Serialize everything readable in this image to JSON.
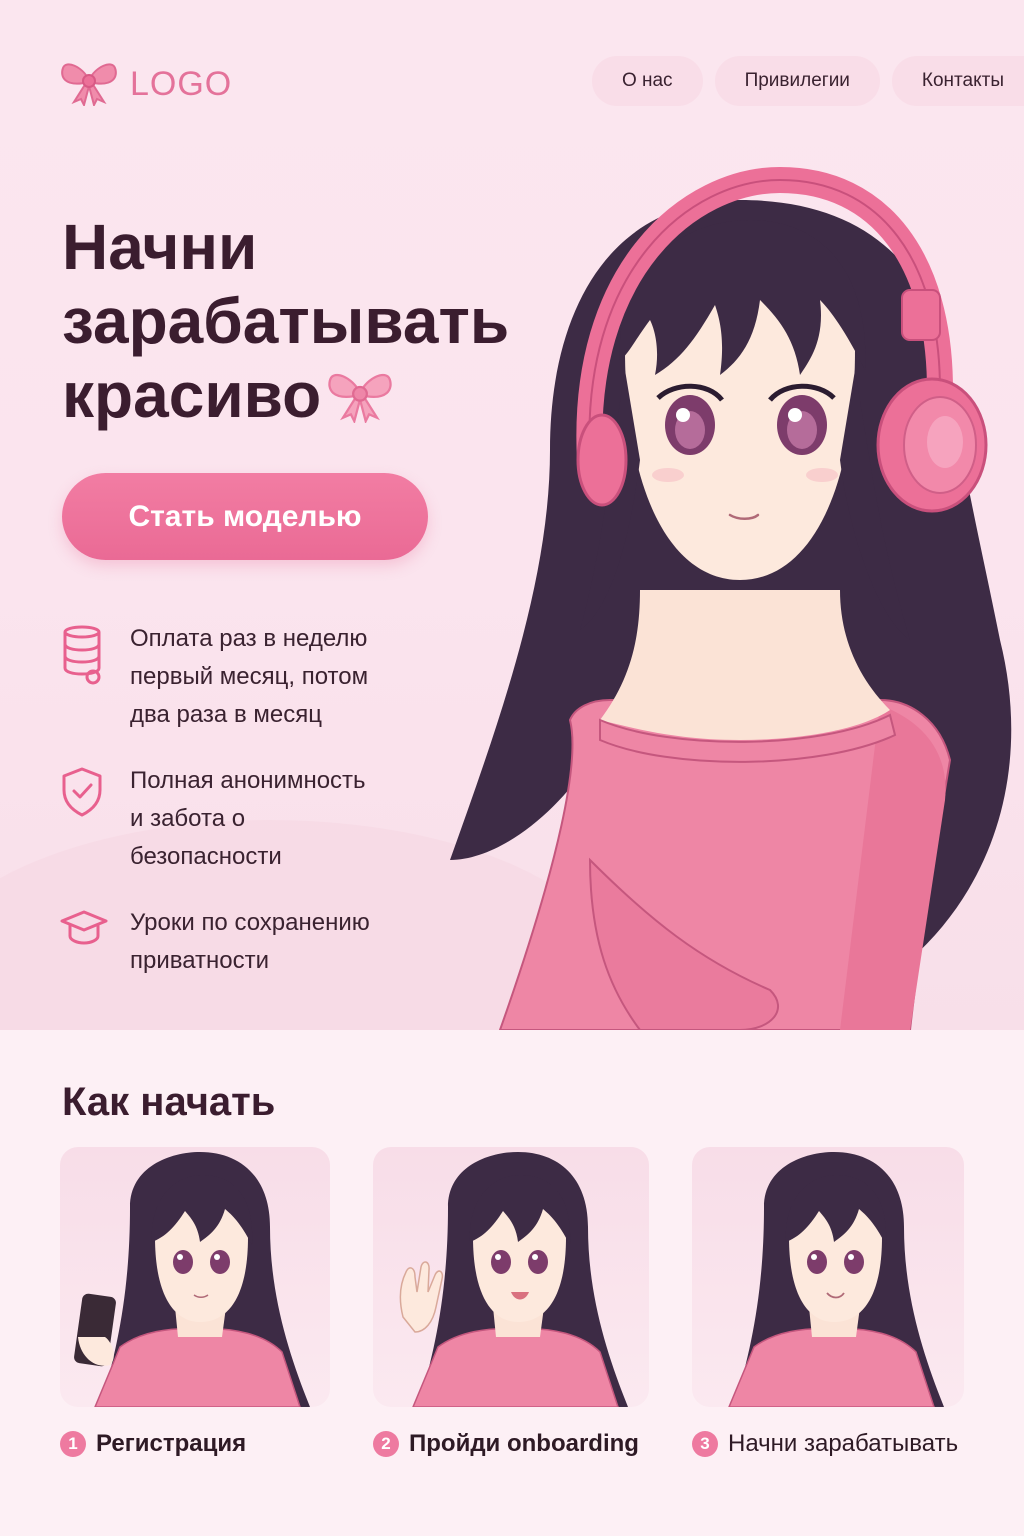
{
  "colors": {
    "accent": "#ec7098",
    "text_dark": "#3b1d2f",
    "hair": "#3d2b45",
    "background": "#fbe6ef"
  },
  "header": {
    "logo_text": "LOGO",
    "logo_icon": "bow-icon",
    "nav": [
      {
        "label": "О нас"
      },
      {
        "label": "Привилегии"
      },
      {
        "label": "Контакты"
      }
    ]
  },
  "hero": {
    "headline": [
      "Начни",
      "зарабатывать",
      "красиво"
    ],
    "headline_icon": "bow-icon",
    "cta_label": "Стать моделью",
    "features": [
      {
        "icon": "coins-icon",
        "text": "Оплата раз в неделю\nпервый месяц, потом\nдва раза в месяц"
      },
      {
        "icon": "shield-check-icon",
        "text": "Полная анонимность\nи забота о\nбезопасности"
      },
      {
        "icon": "graduation-cap-icon",
        "text": "Уроки по сохранению\nприватности"
      }
    ]
  },
  "how": {
    "title": "Как начать",
    "steps": [
      {
        "number": "1",
        "label": "Регистрация",
        "image": "girl-holding-phone"
      },
      {
        "number": "2",
        "label": "Пройди onboarding",
        "image": "girl-waving"
      },
      {
        "number": "3",
        "label": "Начни зарабатывать",
        "image": "girl-smiling"
      }
    ]
  }
}
